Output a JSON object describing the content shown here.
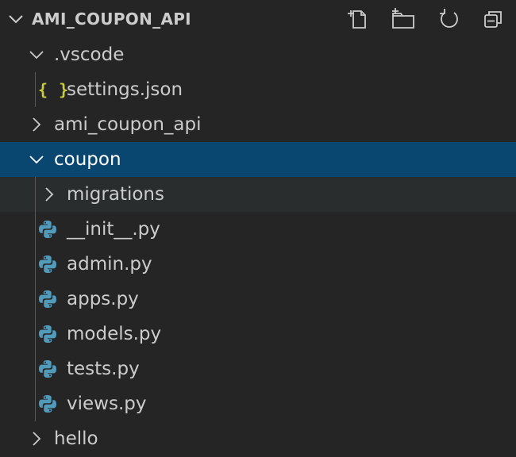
{
  "explorer": {
    "title": "AMI_COUPON_API",
    "toolbar": {
      "new_file": "new-file-icon",
      "new_folder": "new-folder-icon",
      "refresh": "refresh-icon",
      "collapse_all": "collapse-all-icon"
    }
  },
  "tree": {
    "vscode": {
      "label": ".vscode",
      "expanded": true
    },
    "settings": {
      "label": "settings.json",
      "icon": "json-icon",
      "icon_glyph": "{ }"
    },
    "ami_coupon_api": {
      "label": "ami_coupon_api",
      "expanded": false
    },
    "coupon": {
      "label": "coupon",
      "expanded": true,
      "selected": true
    },
    "migrations": {
      "label": "migrations",
      "expanded": false
    },
    "files": [
      {
        "label": "__init__.py",
        "icon": "python-icon"
      },
      {
        "label": "admin.py",
        "icon": "python-icon"
      },
      {
        "label": "apps.py",
        "icon": "python-icon"
      },
      {
        "label": "models.py",
        "icon": "python-icon"
      },
      {
        "label": "tests.py",
        "icon": "python-icon"
      },
      {
        "label": "views.py",
        "icon": "python-icon"
      }
    ],
    "hello": {
      "label": "hello",
      "expanded": false
    }
  },
  "colors": {
    "background": "#252526",
    "selection": "#094771",
    "hover": "#2a2d2e",
    "text": "#cccccc",
    "json_icon": "#cbcb41",
    "python_icon": "#519aba"
  }
}
